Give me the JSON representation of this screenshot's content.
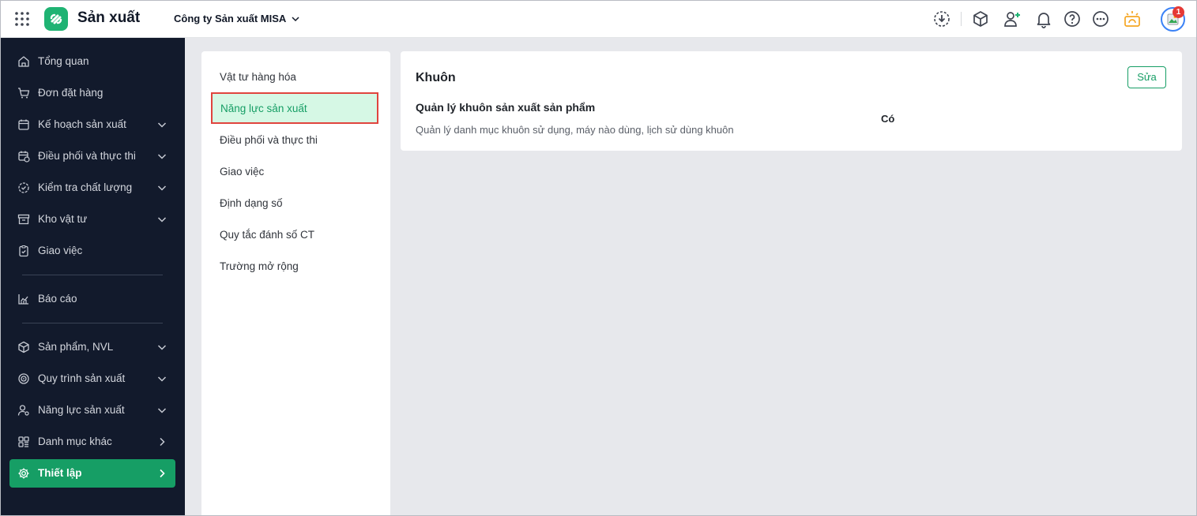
{
  "header": {
    "app_title": "Sản xuất",
    "company": "Công ty Sản xuất MISA",
    "notification_count": "1"
  },
  "sidebar": {
    "items": [
      {
        "label": "Tổng quan",
        "icon": "home-icon"
      },
      {
        "label": "Đơn đặt hàng",
        "icon": "cart-icon"
      },
      {
        "label": "Kế hoạch sản xuất",
        "icon": "calendar-icon"
      },
      {
        "label": "Điều phối và thực thi",
        "icon": "calendar-clock-icon"
      },
      {
        "label": "Kiểm tra chất lượng",
        "icon": "check-circle-icon"
      },
      {
        "label": "Kho vật tư",
        "icon": "archive-icon"
      },
      {
        "label": "Giao việc",
        "icon": "clipboard-icon"
      },
      {
        "label": "Báo cáo",
        "icon": "chart-icon"
      },
      {
        "label": "Sản phẩm, NVL",
        "icon": "box-icon"
      },
      {
        "label": "Quy trình sản xuất",
        "icon": "process-icon"
      },
      {
        "label": "Năng lực sản xuất",
        "icon": "user-gear-icon"
      },
      {
        "label": "Danh mục khác",
        "icon": "grid-icon"
      },
      {
        "label": "Thiết lập",
        "icon": "gear-icon"
      }
    ]
  },
  "submenu": {
    "items": [
      {
        "label": "Vật tư hàng hóa"
      },
      {
        "label": "Năng lực sản xuất"
      },
      {
        "label": "Điều phối và thực thi"
      },
      {
        "label": "Giao việc"
      },
      {
        "label": "Định dạng số"
      },
      {
        "label": "Quy tắc đánh số CT"
      },
      {
        "label": "Trường mở rộng"
      }
    ],
    "selected": "Năng lực sản xuất"
  },
  "content": {
    "section_title": "Khuôn",
    "edit_label": "Sửa",
    "setting_name": "Quản lý khuôn sản xuất sản phẩm",
    "setting_description": "Quản lý danh mục khuôn sử dụng, máy nào dùng, lịch sử dùng khuôn",
    "setting_value": "Có"
  },
  "colors": {
    "sidebar_bg": "#121a2c",
    "accent": "#169e65",
    "selected_bg": "#d6f8e5",
    "highlight_border": "#e0443e",
    "warning_icon": "#f5a623",
    "badge": "#e53935"
  }
}
